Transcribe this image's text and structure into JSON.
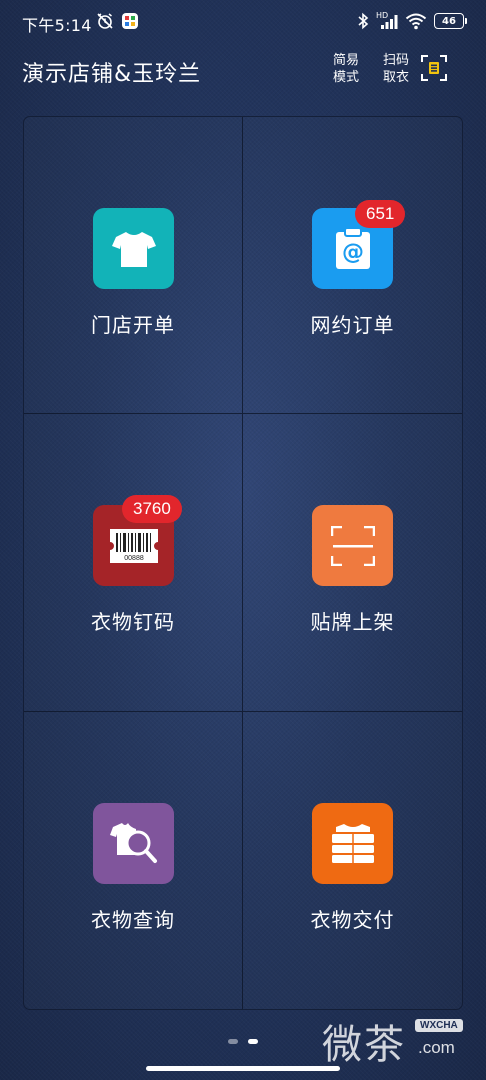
{
  "status_bar": {
    "time": "下午5:14",
    "hd": "HD",
    "battery": "46"
  },
  "header": {
    "title": "演示店铺&玉玲兰",
    "mode_line1": "简易",
    "mode_line2": "模式",
    "scan_line1": "扫码",
    "scan_line2": "取衣"
  },
  "tiles": [
    {
      "label": "门店开单",
      "icon": "tshirt-icon",
      "color": "#12b3b8"
    },
    {
      "label": "网约订单",
      "icon": "clipboard-at-icon",
      "color": "#1a9cf0",
      "badge": "651"
    },
    {
      "label": "衣物钉码",
      "icon": "barcode-tag-icon",
      "color": "#a52428",
      "badge": "3760",
      "barcode_digits": "00888"
    },
    {
      "label": "贴牌上架",
      "icon": "scan-frame-icon",
      "color": "#ef7a3f"
    },
    {
      "label": "衣物查询",
      "icon": "clothing-search-icon",
      "color": "#80559c"
    },
    {
      "label": "衣物交付",
      "icon": "folded-clothes-icon",
      "color": "#ef6a12"
    }
  ],
  "pagination": {
    "pages": 2,
    "current": 2
  },
  "watermark": {
    "chars": "微茶",
    "badge": "WXCHA",
    "domain": ".com"
  }
}
